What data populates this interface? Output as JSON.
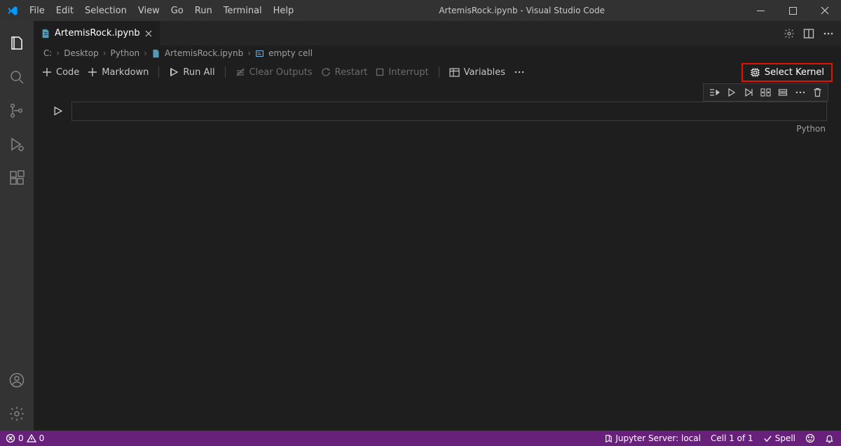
{
  "title_bar": {
    "menus": [
      "File",
      "Edit",
      "Selection",
      "View",
      "Go",
      "Run",
      "Terminal",
      "Help"
    ],
    "title": "ArtemisRock.ipynb - Visual Studio Code"
  },
  "tab": {
    "filename": "ArtemisRock.ipynb"
  },
  "breadcrumb": {
    "parts": [
      "C:",
      "Desktop",
      "Python",
      "ArtemisRock.ipynb",
      "empty cell"
    ]
  },
  "nb_toolbar": {
    "code": "Code",
    "markdown": "Markdown",
    "run_all": "Run All",
    "clear_outputs": "Clear Outputs",
    "restart": "Restart",
    "interrupt": "Interrupt",
    "variables": "Variables",
    "select_kernel": "Select Kernel"
  },
  "cell": {
    "language": "Python"
  },
  "status_bar": {
    "errors": "0",
    "warnings": "0",
    "jupyter": "Jupyter Server: local",
    "cell_pos": "Cell 1 of 1",
    "spell": "Spell"
  }
}
